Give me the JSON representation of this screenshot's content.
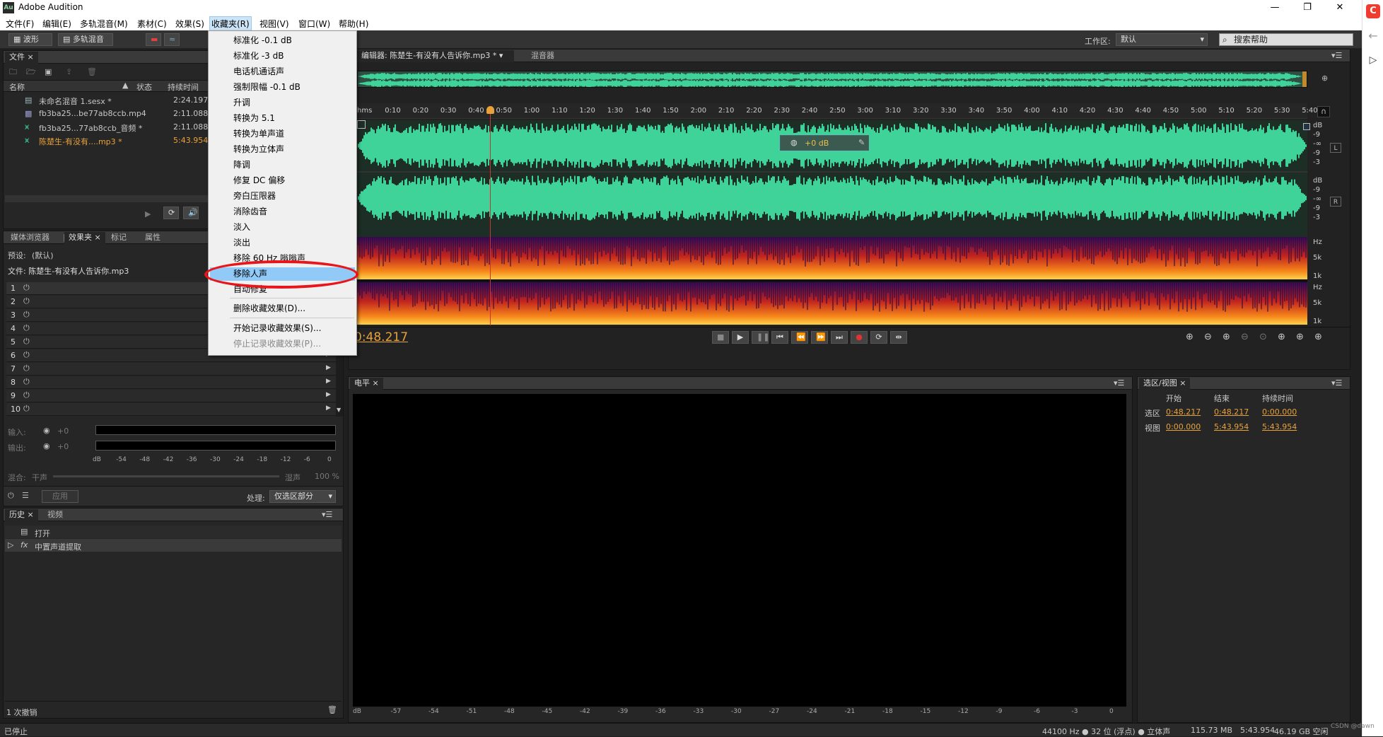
{
  "app": {
    "title": "Adobe Audition",
    "logo": "Au"
  },
  "menubar": [
    "文件(F)",
    "编辑(E)",
    "多轨混音(M)",
    "素材(C)",
    "效果(S)",
    "收藏夹(R)",
    "视图(V)",
    "窗口(W)",
    "帮助(H)"
  ],
  "toolbar": {
    "waveform": "波形",
    "multitrack": "多轨混音",
    "workspace_label": "工作区:",
    "workspace_value": "默认",
    "search_placeholder": "搜索帮助"
  },
  "favorites_menu": {
    "items": [
      "标准化 -0.1 dB",
      "标准化 -3 dB",
      "电话机通话声",
      "强制限幅 -0.1 dB",
      "升调",
      "转换为 5.1",
      "转换为单声道",
      "转换为立体声",
      "降调",
      "修复 DC 偏移",
      "旁白压限器",
      "消除齿音",
      "淡入",
      "淡出",
      "移除 60 Hz 嗡嗡声",
      "移除人声",
      "自动修复"
    ],
    "highlighted": "移除人声",
    "extra": [
      "删除收藏效果(D)...",
      "开始记录收藏效果(S)...",
      "停止记录收藏效果(P)..."
    ]
  },
  "files_panel": {
    "tab": "文件",
    "columns": [
      "名称",
      "状态",
      "持续时间"
    ],
    "rows": [
      {
        "name": "未命名混音 1.sesx *",
        "duration": "2:24.197"
      },
      {
        "name": "fb3ba25...be77ab8ccb.mp4",
        "duration": "2:11.088"
      },
      {
        "name": "fb3ba25...77ab8ccb_音频 *",
        "duration": "2:11.088"
      },
      {
        "name": "陈楚生-有没有....mp3 *",
        "duration": "5:43.954"
      }
    ]
  },
  "effects_panel": {
    "tabs": [
      "媒体浏览器",
      "效果夹",
      "标记",
      "属性"
    ],
    "preset_label": "预设:",
    "preset_value": "(默认)",
    "file_label": "文件: 陈楚生-有没有人告诉你.mp3",
    "slots": [
      "1",
      "2",
      "3",
      "4",
      "5",
      "6",
      "7",
      "8",
      "9",
      "10"
    ],
    "input_label": "输入:",
    "output_label": "输出:",
    "gain": "+0",
    "mix_label": "混合:",
    "dry": "干声",
    "wet": "湿声",
    "mix_pct": "100 %",
    "meter_ticks": [
      "dB",
      "-54",
      "-48",
      "-42",
      "-36",
      "-30",
      "-24",
      "-18",
      "-12",
      "-6",
      "0"
    ],
    "apply": "应用",
    "process_label": "处理:",
    "process_value": "仅选区部分"
  },
  "history_panel": {
    "tabs": [
      "历史",
      "视频"
    ],
    "items": [
      "打开",
      "中置声道提取"
    ],
    "undo_count": "1 次撤销"
  },
  "editor": {
    "tabs": [
      "编辑器: 陈楚生-有没有人告诉你.mp3 *",
      "混音器"
    ],
    "ruler": [
      "hms",
      "0:10",
      "0:20",
      "0:30",
      "0:40",
      "0:50",
      "1:00",
      "1:10",
      "1:20",
      "1:30",
      "1:40",
      "1:50",
      "2:00",
      "2:10",
      "2:20",
      "2:30",
      "2:40",
      "2:50",
      "3:00",
      "3:10",
      "3:20",
      "3:30",
      "3:40",
      "3:50",
      "4:00",
      "4:10",
      "4:20",
      "4:30",
      "4:40",
      "4:50",
      "5:00",
      "5:10",
      "5:20",
      "5:30",
      "5:40"
    ],
    "hud_gain": "+0 dB",
    "db_scale": [
      "dB",
      "-9",
      "-∞",
      "-9",
      "-3"
    ],
    "hz_scale": [
      "Hz",
      "5k",
      "1k"
    ],
    "channels": [
      "L",
      "R"
    ],
    "current_time": "0:48.217",
    "playhead_fraction": 0.14
  },
  "level_panel": {
    "tab": "电平",
    "ticks": [
      "dB",
      "-57",
      "-54",
      "-51",
      "-48",
      "-45",
      "-42",
      "-39",
      "-36",
      "-33",
      "-30",
      "-27",
      "-24",
      "-21",
      "-18",
      "-15",
      "-12",
      "-9",
      "-6",
      "-3",
      "0"
    ]
  },
  "selection_panel": {
    "tab": "选区/视图",
    "headers": [
      "开始",
      "结束",
      "持续时间"
    ],
    "rows": [
      {
        "label": "选区",
        "start": "0:48.217",
        "end": "0:48.217",
        "duration": "0:00.000"
      },
      {
        "label": "视图",
        "start": "0:00.000",
        "end": "5:43.954",
        "duration": "5:43.954"
      }
    ]
  },
  "statusbar": {
    "left": "已停止",
    "sample": "44100 Hz ● 32 位 (浮点) ● 立体声",
    "size": "115.73 MB",
    "duration": "5:43.954",
    "free": "46.19 GB 空闲"
  },
  "watermark": "CSDN @dawn",
  "colors": {
    "waveform": "#3fd39a",
    "accent": "#e8a23a",
    "selection_highlight": "#91c9f7",
    "circle": "#e8151b"
  }
}
